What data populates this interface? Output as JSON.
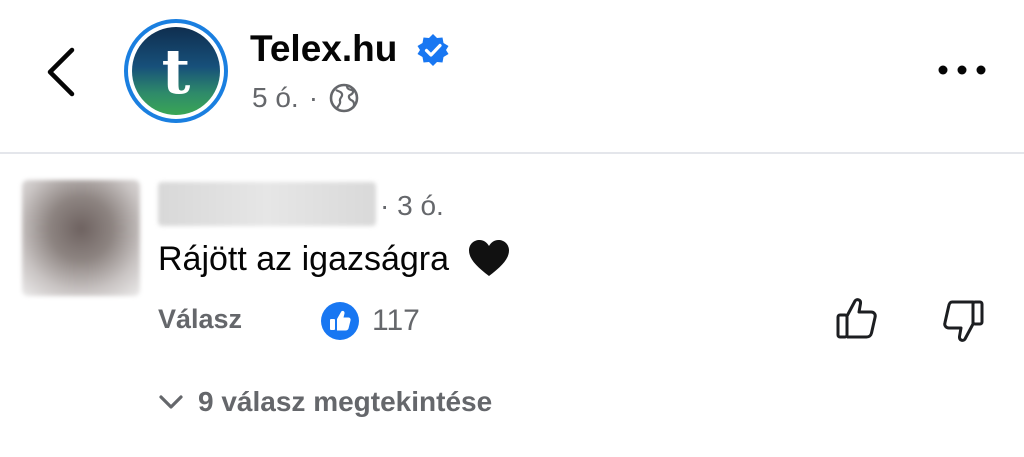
{
  "header": {
    "page_name": "Telex.hu",
    "avatar_letter": "t",
    "time": "5 ó.",
    "separator": "·",
    "verified_color": "#1877f2",
    "icons": [
      "back-arrow-icon",
      "verified-badge-icon",
      "globe-icon",
      "more-options-icon"
    ]
  },
  "comment": {
    "time": "· 3 ó.",
    "text": "Rájött az igazságra",
    "emoji": "black-heart",
    "reply_label": "Válasz",
    "like_count": "117",
    "view_replies_label": "9 válasz megtekintése"
  },
  "colors": {
    "like_blue": "#1877f2",
    "meta_gray": "#65676b",
    "avatar_ring": "#1a7fe0"
  }
}
